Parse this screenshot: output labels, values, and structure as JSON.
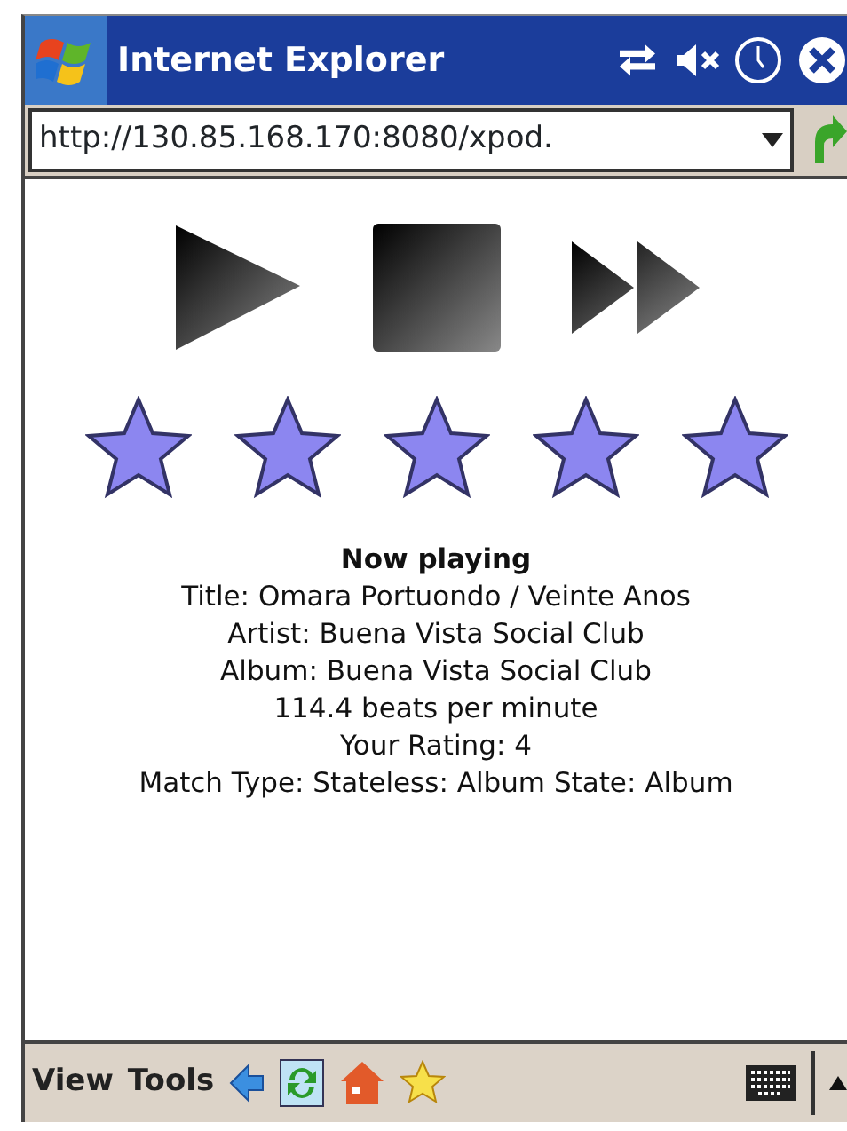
{
  "title_bar": {
    "title": "Internet Explorer"
  },
  "address_bar": {
    "value": "http://130.85.168.170:8080/xpod."
  },
  "rating": {
    "stars": 5
  },
  "now_playing": {
    "heading": "Now playing",
    "lines": [
      "Title: Omara Portuondo / Veinte Anos",
      "Artist: Buena Vista Social Club",
      "Album: Buena Vista Social Club",
      "114.4 beats per minute",
      "Your Rating: 4",
      "Match Type: Stateless: Album State: Album"
    ]
  },
  "menu_bar": {
    "menus": [
      "View",
      "Tools"
    ]
  }
}
